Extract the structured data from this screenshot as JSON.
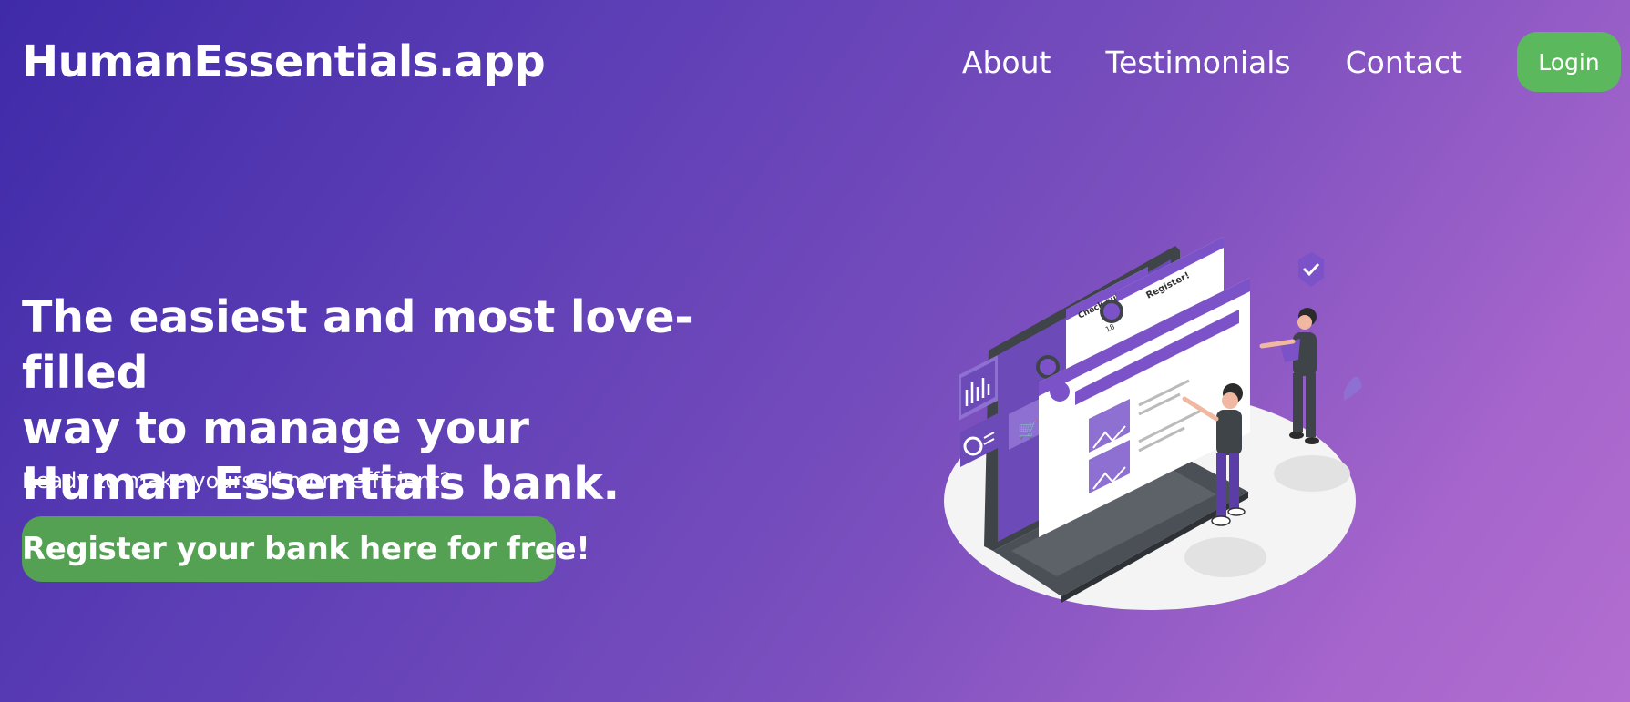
{
  "header": {
    "brand": "HumanEssentials.app",
    "nav": [
      {
        "label": "About"
      },
      {
        "label": "Testimonials"
      },
      {
        "label": "Contact"
      }
    ],
    "login_label": "Login"
  },
  "hero": {
    "title_lines": [
      "The easiest and most love-filled",
      "way to manage your",
      "Human Essentials bank."
    ],
    "subtitle": "Ready to make yourself more efficient?",
    "cta_label": "Register your bank here for free!"
  },
  "illustration": {
    "panel_texts": [
      "Check out",
      "Register!",
      "18"
    ]
  },
  "colors": {
    "gradient_start": "#3f2aa8",
    "gradient_end": "#b36ed0",
    "button_green": "#5cb85c",
    "cta_green": "#55a154",
    "illustration_purple": "#7b52c7"
  }
}
